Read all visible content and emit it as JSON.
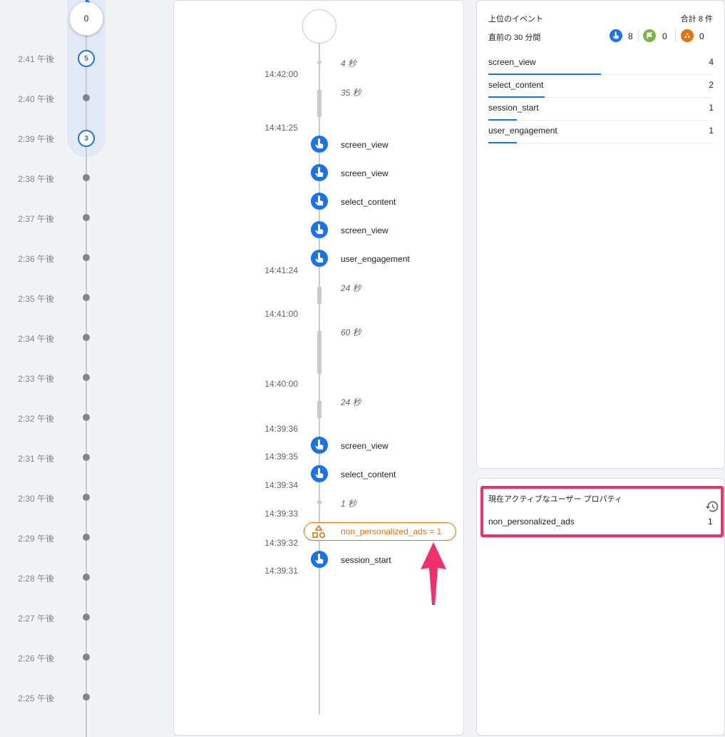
{
  "minute_timeline": {
    "now_count": "0",
    "minutes": [
      {
        "label": "2:41 午後",
        "count": "5"
      },
      {
        "label": "2:40 午後",
        "count": null
      },
      {
        "label": "2:39 午後",
        "count": "3"
      },
      {
        "label": "2:38 午後",
        "count": null
      },
      {
        "label": "2:37 午後",
        "count": null
      },
      {
        "label": "2:36 午後",
        "count": null
      },
      {
        "label": "2:35 午後",
        "count": null
      },
      {
        "label": "2:34 午後",
        "count": null
      },
      {
        "label": "2:33 午後",
        "count": null
      },
      {
        "label": "2:32 午後",
        "count": null
      },
      {
        "label": "2:31 午後",
        "count": null
      },
      {
        "label": "2:30 午後",
        "count": null
      },
      {
        "label": "2:29 午後",
        "count": null
      },
      {
        "label": "2:28 午後",
        "count": null
      },
      {
        "label": "2:27 午後",
        "count": null
      },
      {
        "label": "2:26 午後",
        "count": null
      },
      {
        "label": "2:25 午後",
        "count": null
      }
    ]
  },
  "event_stream": {
    "timestamps": [
      "14:42:00",
      "14:41:25",
      "14:41:24",
      "14:41:00",
      "14:40:00",
      "14:39:36",
      "14:39:35",
      "14:39:34",
      "14:39:33",
      "14:39:32",
      "14:39:31"
    ],
    "gaps": [
      "4 秒",
      "35 秒",
      "24 秒",
      "60 秒",
      "24 秒",
      "1 秒"
    ],
    "events": [
      "screen_view",
      "screen_view",
      "select_content",
      "screen_view",
      "user_engagement",
      "screen_view",
      "select_content",
      "session_start"
    ],
    "property_change": "non_personalized_ads = 1"
  },
  "top_events": {
    "title": "上位のイベント",
    "total": "合計 8 件",
    "subtitle": "直前の 30 分間",
    "counts": {
      "event": "8",
      "conversion": "0",
      "property": "0"
    },
    "colors": {
      "event": "#1a73e8",
      "conversion": "#7cb342",
      "property": "#e8710a"
    },
    "rows": [
      {
        "name": "screen_view",
        "value": "4",
        "share": 0.5
      },
      {
        "name": "select_content",
        "value": "2",
        "share": 0.25
      },
      {
        "name": "session_start",
        "value": "1",
        "share": 0.125
      },
      {
        "name": "user_engagement",
        "value": "1",
        "share": 0.125
      }
    ]
  },
  "active_user_properties": {
    "title": "現在アクティブなユーザー プロパティ",
    "rows": [
      {
        "name": "non_personalized_ads",
        "value": "1"
      }
    ]
  },
  "annotation_color": "#f0306a"
}
